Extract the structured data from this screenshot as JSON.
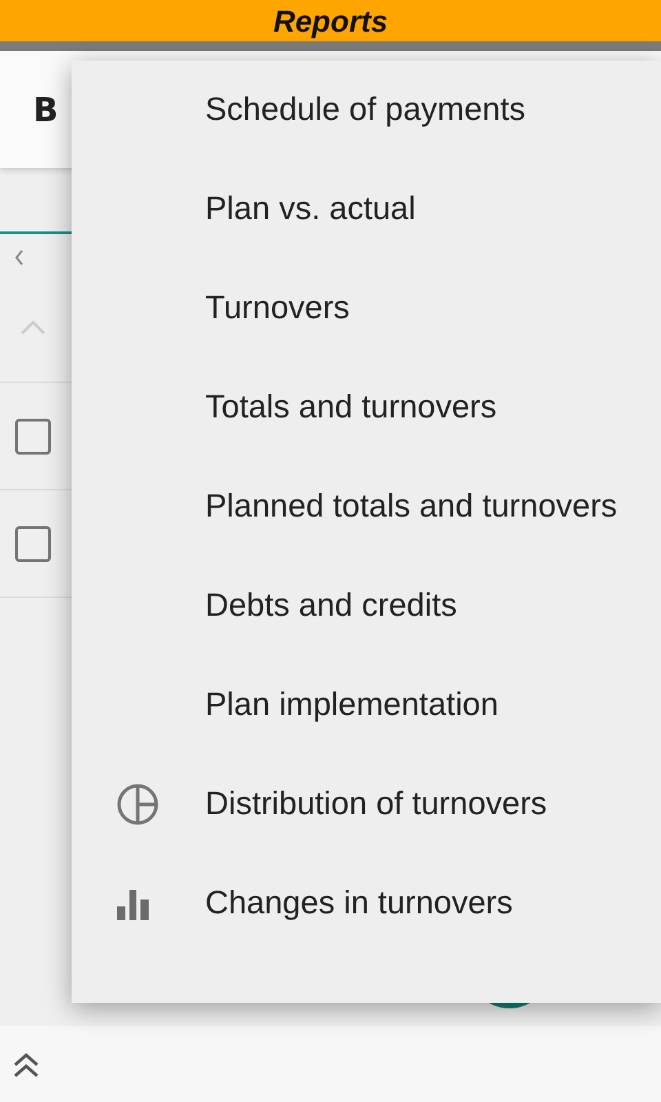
{
  "title_bar": {
    "title": "Reports"
  },
  "background": {
    "header_title": "B",
    "rows": [
      {
        "checked": false
      },
      {
        "checked": false
      }
    ]
  },
  "menu": {
    "items": [
      {
        "label": "Schedule of payments",
        "kind": "text"
      },
      {
        "label": "Plan vs. actual",
        "kind": "text"
      },
      {
        "label": "Turnovers",
        "kind": "text"
      },
      {
        "label": "Totals and turnovers",
        "kind": "text"
      },
      {
        "label": "Planned totals and turnovers",
        "kind": "text"
      },
      {
        "label": "Debts and credits",
        "kind": "text"
      },
      {
        "label": "Plan implementation",
        "kind": "text"
      },
      {
        "label": "Distribution of turnovers",
        "kind": "pie"
      },
      {
        "label": "Changes in turnovers",
        "kind": "bars"
      }
    ]
  }
}
